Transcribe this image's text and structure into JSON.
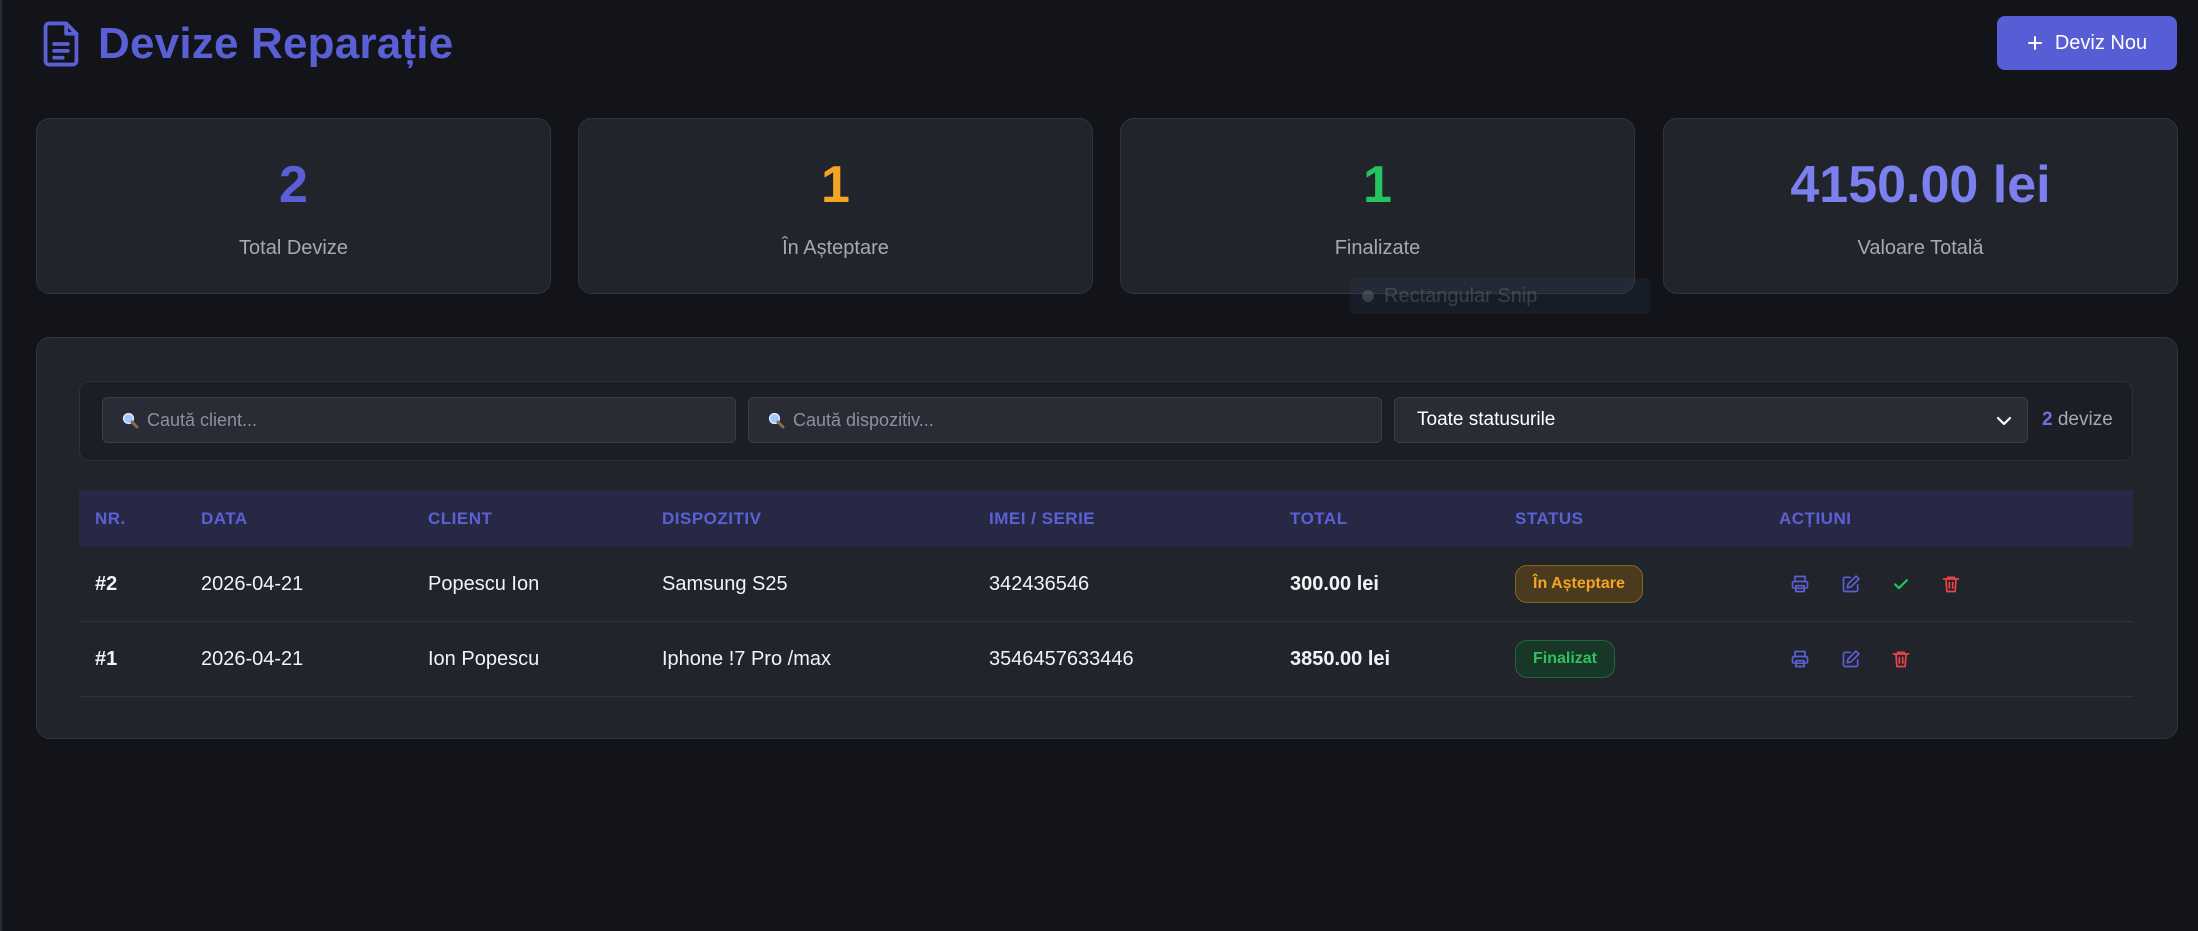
{
  "header": {
    "title": "Devize Reparație",
    "title_icon": "document-icon",
    "new_button_label": "Deviz Nou",
    "new_button_icon": "plus-icon",
    "accent_color": "#575dd4"
  },
  "stats": [
    {
      "value": "2",
      "label": "Total Devize",
      "color": "#5a5fd6"
    },
    {
      "value": "1",
      "label": "În Așteptare",
      "color": "#f5a524"
    },
    {
      "value": "1",
      "label": "Finalizate",
      "color": "#22c55e"
    },
    {
      "value": "4150.00 lei",
      "label": "Valoare Totală",
      "color": "#7c80ee"
    }
  ],
  "overlay": {
    "label": "Rectangular Snip"
  },
  "filters": {
    "client_placeholder": "Caută client...",
    "device_placeholder": "Caută dispozitiv...",
    "status_selected": "Toate statusurile",
    "count_value": "2",
    "count_label": "devize"
  },
  "table": {
    "columns": [
      "NR.",
      "DATA",
      "CLIENT",
      "DISPOZITIV",
      "IMEI / SERIE",
      "TOTAL",
      "STATUS",
      "ACȚIUNI"
    ],
    "rows": [
      {
        "nr": "#2",
        "data": "2026-04-21",
        "client": "Popescu Ion",
        "dispozitiv": "Samsung S25",
        "imei": "342436546",
        "total": "300.00 lei",
        "status": "În Așteptare",
        "status_kind": "pending",
        "actions": [
          "printer-icon",
          "edit-icon",
          "check-icon",
          "trash-icon"
        ]
      },
      {
        "nr": "#1",
        "data": "2026-04-21",
        "client": "Ion Popescu",
        "dispozitiv": "Iphone !7 Pro /max",
        "imei": "3546457633446",
        "total": "3850.00 lei",
        "status": "Finalizat",
        "status_kind": "done",
        "actions": [
          "printer-icon",
          "edit-icon",
          "trash-icon"
        ]
      }
    ]
  }
}
